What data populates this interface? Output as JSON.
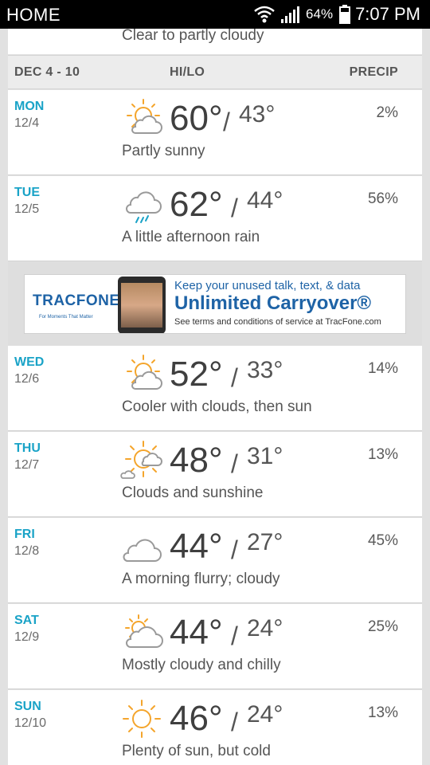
{
  "status_bar": {
    "left_label": "HOME",
    "battery_percent": "64%",
    "time": "7:07 PM"
  },
  "previous_row": {
    "phrase": "Clear to partly cloudy"
  },
  "header": {
    "range": "DEC 4 - 10",
    "hilo": "HI/LO",
    "precip": "PRECIP"
  },
  "days": [
    {
      "name": "MON",
      "date": "12/4",
      "hi": "60°",
      "lo": "43°",
      "precip": "2%",
      "phrase": "Partly sunny",
      "icon": "partly-sunny-icon"
    },
    {
      "name": "TUE",
      "date": "12/5",
      "hi": "62°",
      "lo": "44°",
      "precip": "56%",
      "phrase": "A little afternoon rain",
      "icon": "rain-cloud-icon"
    },
    {
      "name": "WED",
      "date": "12/6",
      "hi": "52°",
      "lo": "33°",
      "precip": "14%",
      "phrase": "Cooler with clouds, then sun",
      "icon": "partly-sunny-icon"
    },
    {
      "name": "THU",
      "date": "12/7",
      "hi": "48°",
      "lo": "31°",
      "precip": "13%",
      "phrase": "Clouds and sunshine",
      "icon": "sun-clouds-icon"
    },
    {
      "name": "FRI",
      "date": "12/8",
      "hi": "44°",
      "lo": "27°",
      "precip": "45%",
      "phrase": "A morning flurry; cloudy",
      "icon": "cloud-icon"
    },
    {
      "name": "SAT",
      "date": "12/9",
      "hi": "44°",
      "lo": "24°",
      "precip": "25%",
      "phrase": "Mostly cloudy and chilly",
      "icon": "mostly-cloudy-icon"
    },
    {
      "name": "SUN",
      "date": "12/10",
      "hi": "46°",
      "lo": "24°",
      "precip": "13%",
      "phrase": "Plenty of sun, but cold",
      "icon": "sun-icon"
    }
  ],
  "ad": {
    "brand": "TRACFONE",
    "tagline": "For Moments That Matter",
    "line1": "Keep your unused talk, text, & data",
    "line2": "Unlimited Carryover®",
    "line3": "See terms and conditions of service at TracFone.com"
  },
  "colors": {
    "accent": "#1aa3c7",
    "sun": "#f4a52c",
    "cloud": "#9a9a9a"
  }
}
